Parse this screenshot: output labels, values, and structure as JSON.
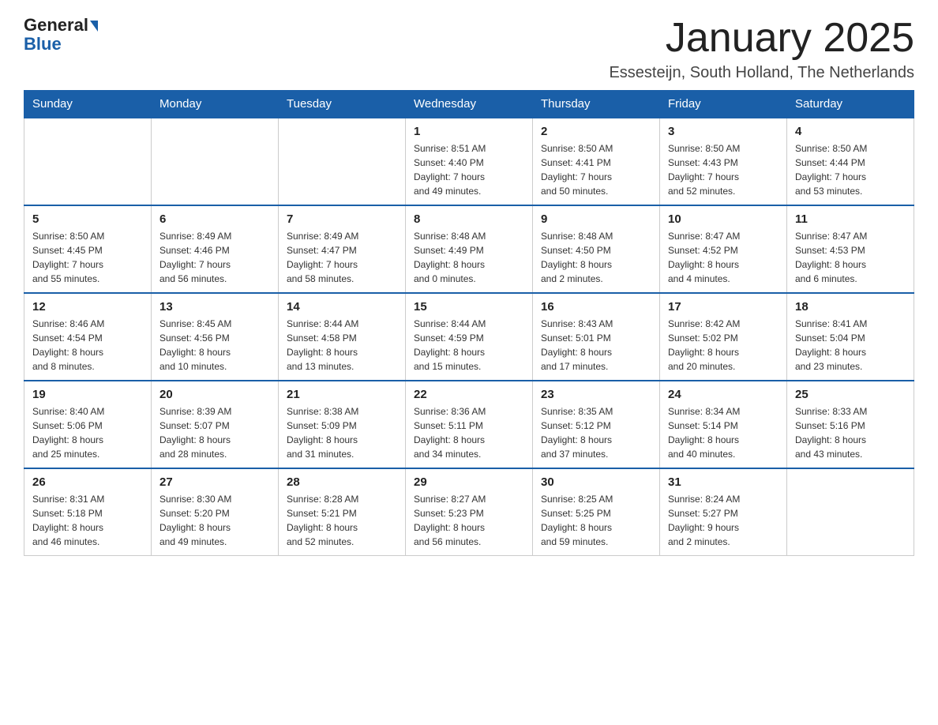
{
  "header": {
    "logo_general": "General",
    "logo_blue": "Blue",
    "month_title": "January 2025",
    "subtitle": "Essesteijn, South Holland, The Netherlands"
  },
  "days_of_week": [
    "Sunday",
    "Monday",
    "Tuesday",
    "Wednesday",
    "Thursday",
    "Friday",
    "Saturday"
  ],
  "weeks": [
    [
      {
        "day": "",
        "info": ""
      },
      {
        "day": "",
        "info": ""
      },
      {
        "day": "",
        "info": ""
      },
      {
        "day": "1",
        "info": "Sunrise: 8:51 AM\nSunset: 4:40 PM\nDaylight: 7 hours\nand 49 minutes."
      },
      {
        "day": "2",
        "info": "Sunrise: 8:50 AM\nSunset: 4:41 PM\nDaylight: 7 hours\nand 50 minutes."
      },
      {
        "day": "3",
        "info": "Sunrise: 8:50 AM\nSunset: 4:43 PM\nDaylight: 7 hours\nand 52 minutes."
      },
      {
        "day": "4",
        "info": "Sunrise: 8:50 AM\nSunset: 4:44 PM\nDaylight: 7 hours\nand 53 minutes."
      }
    ],
    [
      {
        "day": "5",
        "info": "Sunrise: 8:50 AM\nSunset: 4:45 PM\nDaylight: 7 hours\nand 55 minutes."
      },
      {
        "day": "6",
        "info": "Sunrise: 8:49 AM\nSunset: 4:46 PM\nDaylight: 7 hours\nand 56 minutes."
      },
      {
        "day": "7",
        "info": "Sunrise: 8:49 AM\nSunset: 4:47 PM\nDaylight: 7 hours\nand 58 minutes."
      },
      {
        "day": "8",
        "info": "Sunrise: 8:48 AM\nSunset: 4:49 PM\nDaylight: 8 hours\nand 0 minutes."
      },
      {
        "day": "9",
        "info": "Sunrise: 8:48 AM\nSunset: 4:50 PM\nDaylight: 8 hours\nand 2 minutes."
      },
      {
        "day": "10",
        "info": "Sunrise: 8:47 AM\nSunset: 4:52 PM\nDaylight: 8 hours\nand 4 minutes."
      },
      {
        "day": "11",
        "info": "Sunrise: 8:47 AM\nSunset: 4:53 PM\nDaylight: 8 hours\nand 6 minutes."
      }
    ],
    [
      {
        "day": "12",
        "info": "Sunrise: 8:46 AM\nSunset: 4:54 PM\nDaylight: 8 hours\nand 8 minutes."
      },
      {
        "day": "13",
        "info": "Sunrise: 8:45 AM\nSunset: 4:56 PM\nDaylight: 8 hours\nand 10 minutes."
      },
      {
        "day": "14",
        "info": "Sunrise: 8:44 AM\nSunset: 4:58 PM\nDaylight: 8 hours\nand 13 minutes."
      },
      {
        "day": "15",
        "info": "Sunrise: 8:44 AM\nSunset: 4:59 PM\nDaylight: 8 hours\nand 15 minutes."
      },
      {
        "day": "16",
        "info": "Sunrise: 8:43 AM\nSunset: 5:01 PM\nDaylight: 8 hours\nand 17 minutes."
      },
      {
        "day": "17",
        "info": "Sunrise: 8:42 AM\nSunset: 5:02 PM\nDaylight: 8 hours\nand 20 minutes."
      },
      {
        "day": "18",
        "info": "Sunrise: 8:41 AM\nSunset: 5:04 PM\nDaylight: 8 hours\nand 23 minutes."
      }
    ],
    [
      {
        "day": "19",
        "info": "Sunrise: 8:40 AM\nSunset: 5:06 PM\nDaylight: 8 hours\nand 25 minutes."
      },
      {
        "day": "20",
        "info": "Sunrise: 8:39 AM\nSunset: 5:07 PM\nDaylight: 8 hours\nand 28 minutes."
      },
      {
        "day": "21",
        "info": "Sunrise: 8:38 AM\nSunset: 5:09 PM\nDaylight: 8 hours\nand 31 minutes."
      },
      {
        "day": "22",
        "info": "Sunrise: 8:36 AM\nSunset: 5:11 PM\nDaylight: 8 hours\nand 34 minutes."
      },
      {
        "day": "23",
        "info": "Sunrise: 8:35 AM\nSunset: 5:12 PM\nDaylight: 8 hours\nand 37 minutes."
      },
      {
        "day": "24",
        "info": "Sunrise: 8:34 AM\nSunset: 5:14 PM\nDaylight: 8 hours\nand 40 minutes."
      },
      {
        "day": "25",
        "info": "Sunrise: 8:33 AM\nSunset: 5:16 PM\nDaylight: 8 hours\nand 43 minutes."
      }
    ],
    [
      {
        "day": "26",
        "info": "Sunrise: 8:31 AM\nSunset: 5:18 PM\nDaylight: 8 hours\nand 46 minutes."
      },
      {
        "day": "27",
        "info": "Sunrise: 8:30 AM\nSunset: 5:20 PM\nDaylight: 8 hours\nand 49 minutes."
      },
      {
        "day": "28",
        "info": "Sunrise: 8:28 AM\nSunset: 5:21 PM\nDaylight: 8 hours\nand 52 minutes."
      },
      {
        "day": "29",
        "info": "Sunrise: 8:27 AM\nSunset: 5:23 PM\nDaylight: 8 hours\nand 56 minutes."
      },
      {
        "day": "30",
        "info": "Sunrise: 8:25 AM\nSunset: 5:25 PM\nDaylight: 8 hours\nand 59 minutes."
      },
      {
        "day": "31",
        "info": "Sunrise: 8:24 AM\nSunset: 5:27 PM\nDaylight: 9 hours\nand 2 minutes."
      },
      {
        "day": "",
        "info": ""
      }
    ]
  ]
}
